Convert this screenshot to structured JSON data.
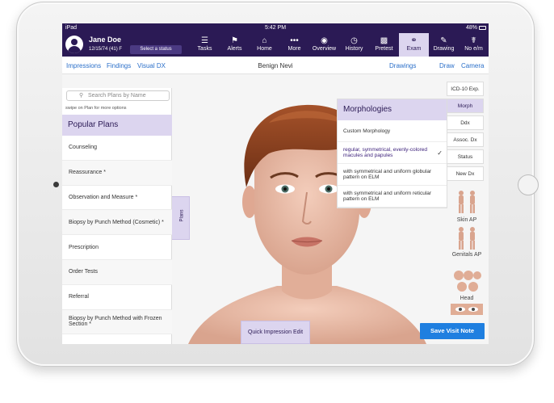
{
  "status_bar": {
    "carrier": "iPad",
    "time": "5:42 PM",
    "battery": "48%"
  },
  "patient": {
    "name": "Jane Doe",
    "info": "12/15/74 (41) F",
    "status_label": "Select a status"
  },
  "nav": [
    {
      "label": "Tasks",
      "icon": "list-icon"
    },
    {
      "label": "Alerts",
      "icon": "megaphone-icon"
    },
    {
      "label": "Home",
      "icon": "home-icon"
    },
    {
      "label": "More",
      "icon": "more-icon"
    },
    {
      "label": "Overview",
      "icon": "person-icon"
    },
    {
      "label": "History",
      "icon": "clock-icon"
    },
    {
      "label": "Pretest",
      "icon": "clipboard-icon"
    },
    {
      "label": "Exam",
      "icon": "stethoscope-icon"
    },
    {
      "label": "Drawing",
      "icon": "pen-icon"
    },
    {
      "label": "No e/m",
      "icon": "caduceus-icon"
    }
  ],
  "subheader": {
    "impressions": "Impressions",
    "findings": "Findings",
    "visual_dx": "Visual DX",
    "title": "Benign Nevi",
    "drawings": "Drawings",
    "draw": "Draw",
    "camera": "Camera"
  },
  "plans": {
    "search_placeholder": "Search Plans by Name",
    "hint": "swipe on Plan for more options",
    "header": "Popular Plans",
    "items": [
      "Counseling",
      "Reassurance *",
      "Observation and Measure *",
      "Biopsy by Punch Method (Cosmetic) *",
      "Prescription",
      "Order Tests",
      "Referral",
      "Biopsy by Punch Method with Frozen Section *"
    ],
    "tab_label": "Plans"
  },
  "morphologies": {
    "header": "Morphologies",
    "items": [
      "Custom Morphology",
      "regular, symmetrical, evenly-colored macules and papules",
      "with symmetrical and uniform globular pattern on ELM",
      "with symmetrical and uniform reticular pattern on ELM"
    ]
  },
  "tools": [
    "ICD-10 Exp.",
    "Morph",
    "Ddx",
    "Assoc. Dx",
    "Status",
    "New Dx"
  ],
  "thumbs": {
    "skin": "Skin AP",
    "genitals": "Genitals AP",
    "head": "Head"
  },
  "quick_edit": "Quick Impression Edit",
  "save": "Save Visit Note",
  "colors": {
    "header": "#2b1a55",
    "accent": "#dcd5ef",
    "primary": "#1f7fe0"
  }
}
